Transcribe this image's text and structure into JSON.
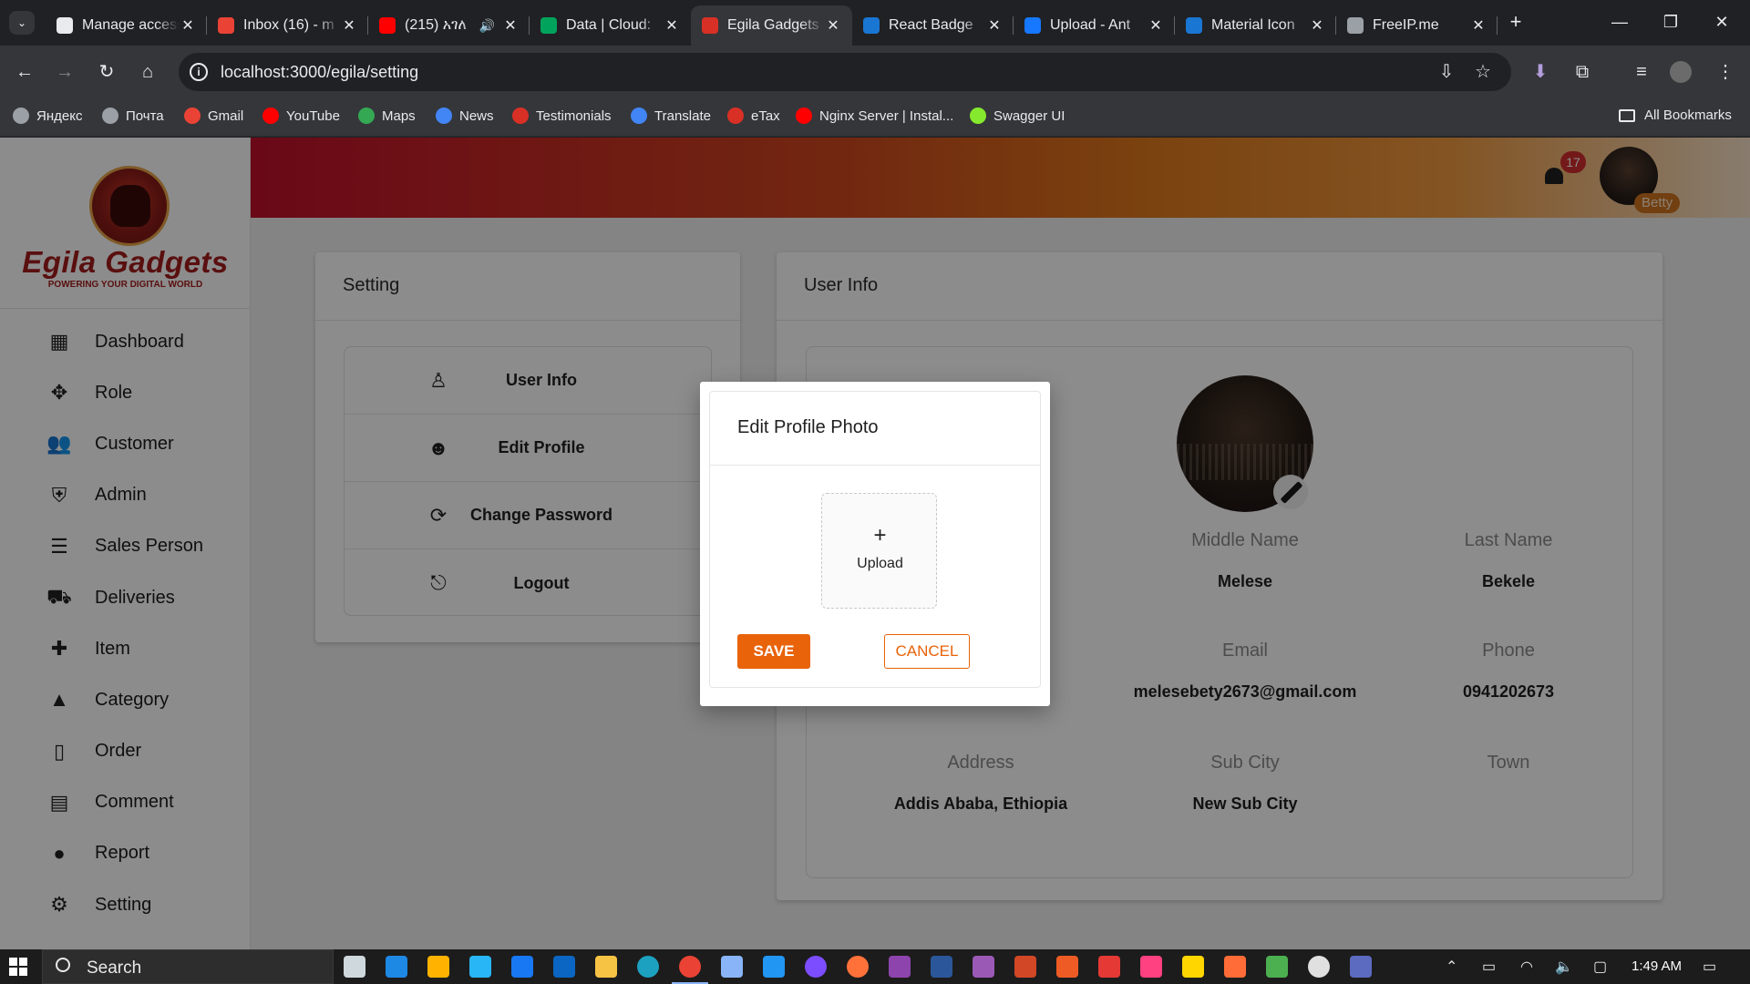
{
  "browser": {
    "tabs": [
      {
        "title": "Manage access",
        "color": "#e8eaed",
        "icon": "github-icon",
        "x": "✕"
      },
      {
        "title": "Inbox (16) - m",
        "color": "#ea4335",
        "icon": "gmail-icon",
        "x": "✕"
      },
      {
        "title": "(215) አገለ",
        "color": "#ff0000",
        "icon": "youtube-icon",
        "x": "✕",
        "sound": "🔊"
      },
      {
        "title": "Data | Cloud:",
        "color": "#00a35c",
        "icon": "mongodb-icon",
        "x": "✕"
      },
      {
        "title": "Egila Gadgets",
        "color": "#d93025",
        "icon": "egila-icon",
        "x": "✕"
      },
      {
        "title": "React Badge",
        "color": "#1976d2",
        "icon": "mui-icon",
        "x": "✕"
      },
      {
        "title": "Upload - Ant",
        "color": "#1677ff",
        "icon": "antd-icon",
        "x": "✕"
      },
      {
        "title": "Material Icon",
        "color": "#1976d2",
        "icon": "mui-icon",
        "x": "✕"
      },
      {
        "title": "FreeIP.me",
        "color": "#9aa0a6",
        "icon": "freeip-icon",
        "x": "✕"
      }
    ],
    "new_tab": "+",
    "window": {
      "minimize": "—",
      "restore": "❐",
      "close": "✕"
    },
    "nav": {
      "back": "←",
      "forward": "→",
      "reload": "↻",
      "home": "⌂"
    },
    "url": "localhost:3000/egila/setting",
    "info_glyph": "i",
    "toolbar_icons": {
      "install": "⇩",
      "star": "☆",
      "download": "⬇",
      "extensions": "⧉",
      "media": "≡",
      "menu": "⋮"
    },
    "bookmarks": [
      {
        "label": "Яндекс",
        "color": "#9aa0a6"
      },
      {
        "label": "Почта",
        "color": "#9aa0a6"
      },
      {
        "label": "Gmail",
        "color": "#ea4335"
      },
      {
        "label": "YouTube",
        "color": "#ff0000"
      },
      {
        "label": "Maps",
        "color": "#34a853"
      },
      {
        "label": "News",
        "color": "#4285f4"
      },
      {
        "label": "Testimonials",
        "color": "#d93025"
      },
      {
        "label": "Translate",
        "color": "#4285f4"
      },
      {
        "label": "eTax",
        "color": "#d93025"
      },
      {
        "label": "Nginx Server | Instal...",
        "color": "#ff0000"
      },
      {
        "label": "Swagger UI",
        "color": "#85ea2d"
      }
    ],
    "all_bookmarks": "All Bookmarks"
  },
  "app": {
    "brand": "Egila Gadgets",
    "tagline": "POWERING YOUR DIGITAL WORLD",
    "menu": [
      {
        "label": "Dashboard",
        "icon": "dashboard-icon",
        "glyph": "▦"
      },
      {
        "label": "Role",
        "icon": "role-icon",
        "glyph": "✥"
      },
      {
        "label": "Customer",
        "icon": "customer-icon",
        "glyph": "👥"
      },
      {
        "label": "Admin",
        "icon": "admin-shield-icon",
        "glyph": "⛨"
      },
      {
        "label": "Sales Person",
        "icon": "sales-person-icon",
        "glyph": "☰"
      },
      {
        "label": "Deliveries",
        "icon": "deliveries-icon",
        "glyph": "⛟"
      },
      {
        "label": "Item",
        "icon": "item-puzzle-icon",
        "glyph": "✚"
      },
      {
        "label": "Category",
        "icon": "category-icon",
        "glyph": "▲"
      },
      {
        "label": "Order",
        "icon": "order-icon",
        "glyph": "▯"
      },
      {
        "label": "Comment",
        "icon": "comment-icon",
        "glyph": "▤"
      },
      {
        "label": "Report",
        "icon": "report-icon",
        "glyph": "●"
      },
      {
        "label": "Setting",
        "icon": "setting-gear-icon",
        "glyph": "⚙"
      }
    ],
    "notifications": "17",
    "user_name": "Betty",
    "settings": {
      "title": "Setting",
      "items": [
        {
          "label": "User Info",
          "icon": "person-outline-icon",
          "glyph": "♙"
        },
        {
          "label": "Edit Profile",
          "icon": "account-circle-icon",
          "glyph": "☻"
        },
        {
          "label": "Change Password",
          "icon": "password-reset-icon",
          "glyph": "⟳"
        },
        {
          "label": "Logout",
          "icon": "logout-icon",
          "glyph": "⎋"
        }
      ]
    },
    "user_info": {
      "title": "User Info",
      "fields": {
        "middle_name_label": "Middle Name",
        "middle_name": "Melese",
        "last_name_label": "Last Name",
        "last_name": "Bekele",
        "email_label": "Email",
        "email": "melesebety2673@gmail.com",
        "phone_label": "Phone",
        "phone": "0941202673",
        "address_label": "Address",
        "address": "Addis Ababa, Ethiopia",
        "sub_city_label": "Sub City",
        "sub_city": "New Sub City",
        "town_label": "Town"
      }
    },
    "modal": {
      "title": "Edit Profile Photo",
      "upload_plus": "+",
      "upload_label": "Upload",
      "save": "SAVE",
      "cancel": "CANCEL"
    }
  },
  "taskbar": {
    "search": "Search",
    "time": "1:49 AM",
    "apps": [
      {
        "name": "task-view-icon",
        "color": "#cfd8dc"
      },
      {
        "name": "mail-icon",
        "color": "#1e88e5"
      },
      {
        "name": "store-icon",
        "color": "#ffb300"
      },
      {
        "name": "telegram-icon",
        "color": "#29b6f6"
      },
      {
        "name": "facebook-icon",
        "color": "#1877f2"
      },
      {
        "name": "linkedin-icon",
        "color": "#0a66c2"
      },
      {
        "name": "file-explorer-icon",
        "color": "#f6c344"
      },
      {
        "name": "edge-icon",
        "color": "#1da1c1"
      },
      {
        "name": "chrome-icon",
        "color": "#ea4335"
      },
      {
        "name": "virtualbox-icon",
        "color": "#8ab4f8"
      },
      {
        "name": "vscode-icon",
        "color": "#2196f3"
      },
      {
        "name": "eclipse-icon",
        "color": "#7c4dff"
      },
      {
        "name": "firefox-icon",
        "color": "#ff7139"
      },
      {
        "name": "visual-studio-icon",
        "color": "#8e44ad"
      },
      {
        "name": "word-icon",
        "color": "#2b579a"
      },
      {
        "name": "github-desktop-icon",
        "color": "#9b59b6"
      },
      {
        "name": "powerpoint-icon",
        "color": "#d24726"
      },
      {
        "name": "postman-icon",
        "color": "#ef5b25"
      },
      {
        "name": "anydesk-icon",
        "color": "#e53935"
      },
      {
        "name": "color-picker-icon",
        "color": "#ff4081"
      },
      {
        "name": "sticky-notes-icon",
        "color": "#ffd600"
      },
      {
        "name": "postman-orange-icon",
        "color": "#ff6c37"
      },
      {
        "name": "git-kraken-icon",
        "color": "#4caf50"
      },
      {
        "name": "whatsapp-icon",
        "color": "#e0e0e0"
      },
      {
        "name": "cube-app-icon",
        "color": "#5c6bc0"
      }
    ],
    "tray": {
      "chevron": "⌃",
      "battery": "▭",
      "wifi": "◠",
      "volume": "🔈",
      "meet": "▢",
      "notify": "▭"
    }
  }
}
